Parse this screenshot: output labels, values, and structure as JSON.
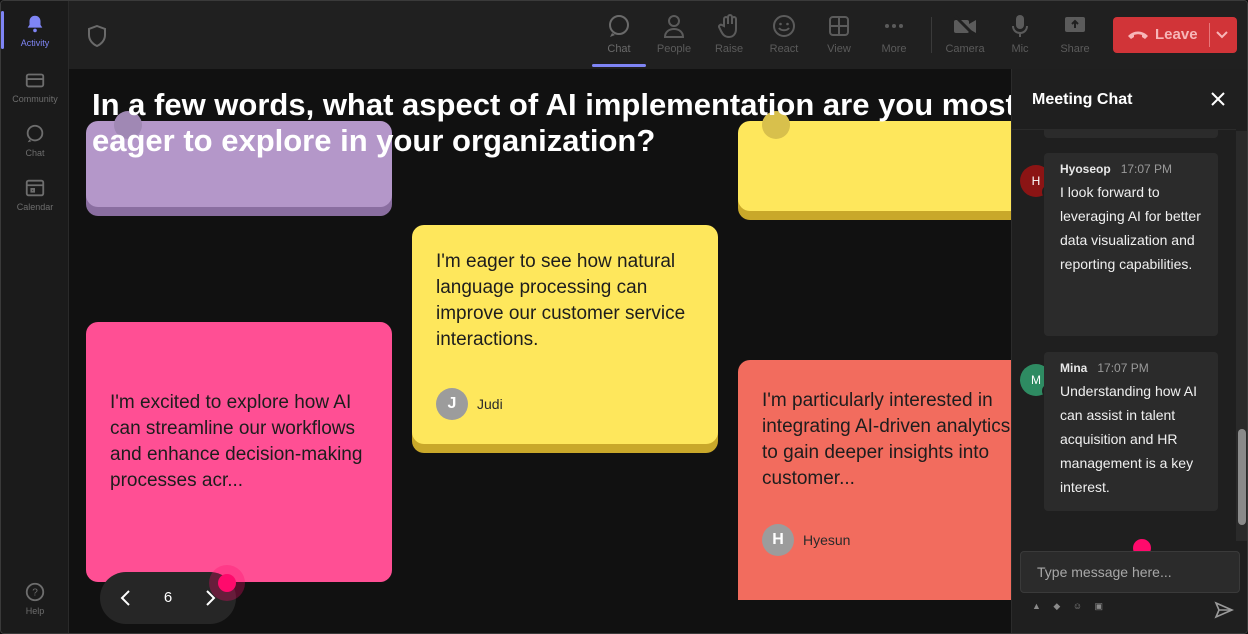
{
  "rail": {
    "items": [
      {
        "label": "Activity",
        "icon": "bell-icon"
      },
      {
        "label": "Community",
        "icon": "community-icon"
      },
      {
        "label": "Chat",
        "icon": "chat-icon"
      },
      {
        "label": "Calendar",
        "icon": "calendar-icon"
      },
      {
        "label": "Help",
        "icon": "help-icon"
      }
    ]
  },
  "toolbar": {
    "chat": "Chat",
    "people": "People",
    "raise": "Raise",
    "react": "React",
    "view": "View",
    "more": "More",
    "camera": "Camera",
    "mic": "Mic",
    "share": "Share",
    "leave": "Leave"
  },
  "stage": {
    "question": "In a few words, what aspect of AI implementation are you most eager to explore in your organization?",
    "notes": [
      {
        "color": "yellow",
        "text": "I'm eager to see how natural language processing can improve our customer service interactions.",
        "author": "Judi",
        "initial": "J"
      },
      {
        "color": "pink",
        "text": "I'm excited to explore how AI can streamline our workflows and enhance decision-making processes acr..."
      },
      {
        "color": "coral",
        "text": "I'm particularly interested in integrating AI-driven analytics to gain deeper insights into customer...",
        "author": "Hyesun",
        "initial": "H"
      }
    ],
    "page": "6"
  },
  "chat": {
    "title": "Meeting Chat",
    "messages": [
      {
        "name": "Hyoseop",
        "time": "17:07 PM",
        "initial": "H",
        "color": "#8b1414",
        "text": "I look forward to leveraging AI for better data visualization and reporting capabilities."
      },
      {
        "name": "Mina",
        "time": "17:07 PM",
        "initial": "M",
        "color": "#2e8b62",
        "text": "Understanding how AI can assist in talent acquisition and HR management is a key interest."
      }
    ],
    "placeholder": "Type message here..."
  },
  "colors": {
    "accent": "#7f85f5",
    "leave": "#d13438",
    "cursor": "#ff0a6c"
  }
}
